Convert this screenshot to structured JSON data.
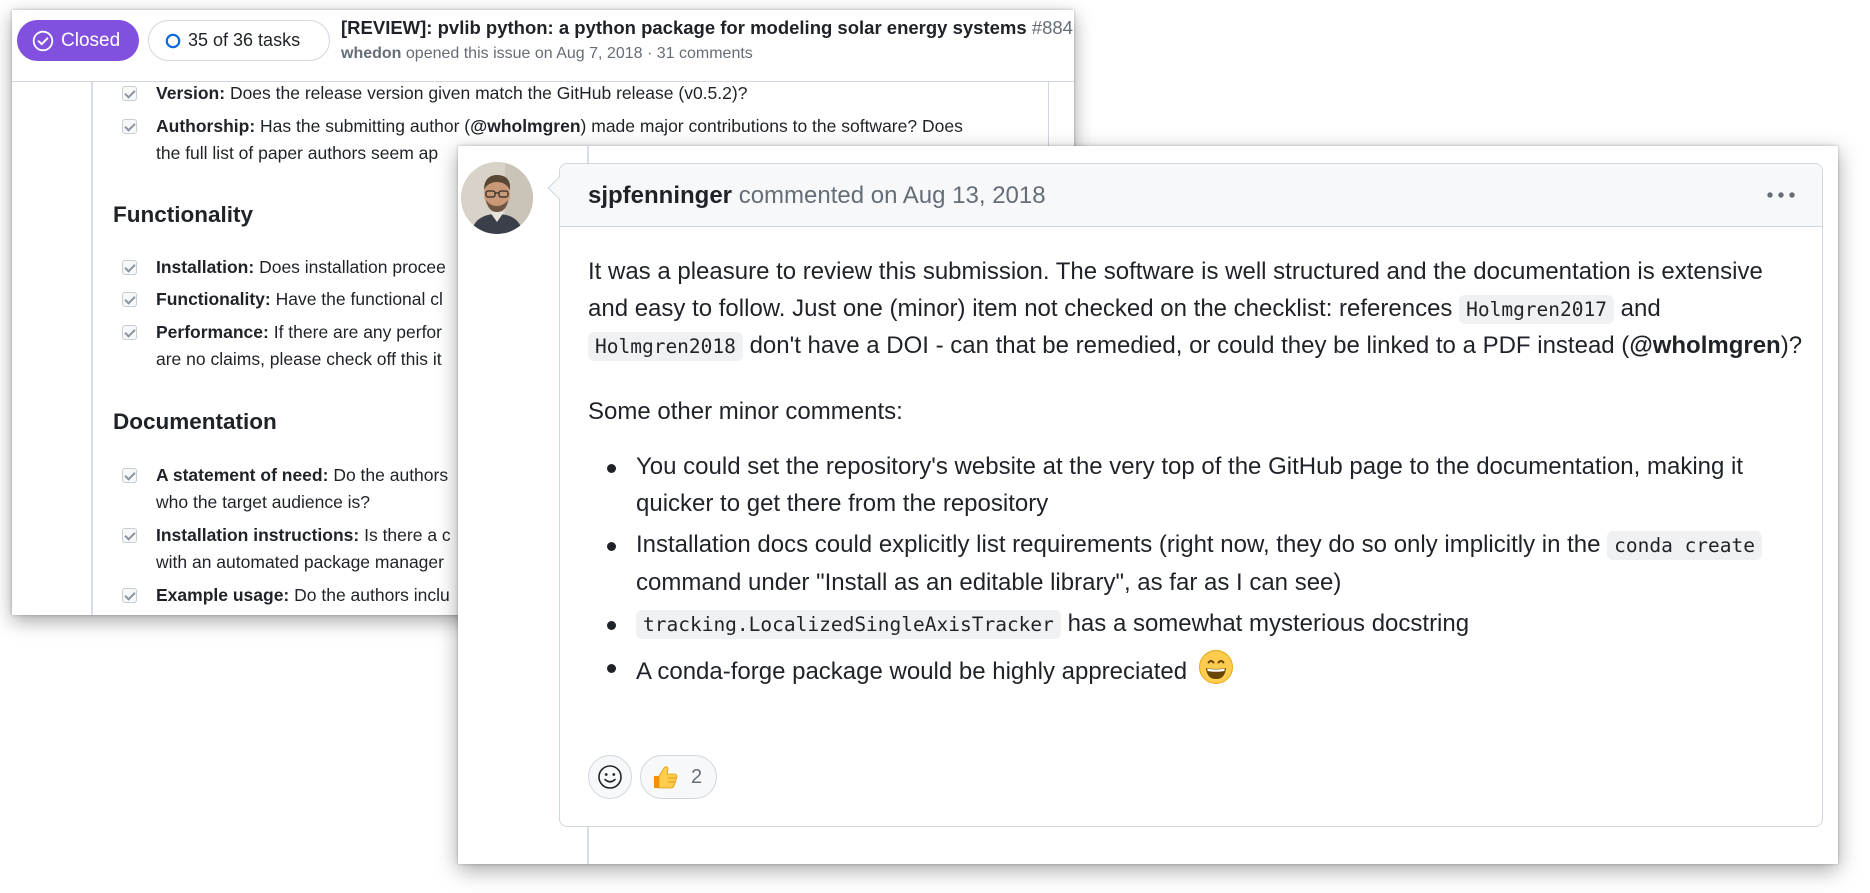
{
  "issue": {
    "state": "Closed",
    "tasks": "35 of 36 tasks",
    "title": "[REVIEW]: pvlib python: a python package for modeling solar energy systems",
    "number": "#884",
    "author": "whedon",
    "meta": "opened this issue on Aug 7, 2018 · 31 comments"
  },
  "checklist": {
    "items_top": [
      {
        "label": "Version:",
        "line1": "Does the release version given match the GitHub release (v0.5.2)?"
      },
      {
        "label": "Authorship:",
        "line1_pre": "Has the submitting author (",
        "mention": "@wholmgren",
        "line1_post": ") made major contributions to the software? Does",
        "line2": "the full list of paper authors seem ap"
      }
    ],
    "sections": [
      {
        "heading": "Functionality",
        "items": [
          {
            "label": "Installation:",
            "text": "Does installation procee"
          },
          {
            "label": "Functionality:",
            "text": "Have the functional cl"
          },
          {
            "label": "Performance:",
            "text": "If there are any perfor",
            "line2": "are no claims, please check off this it"
          }
        ]
      },
      {
        "heading": "Documentation",
        "items": [
          {
            "label": "A statement of need:",
            "text": "Do the authors",
            "line2": "who the target audience is?"
          },
          {
            "label": "Installation instructions:",
            "text": "Is there a c",
            "line2": "with an automated package manager"
          },
          {
            "label": "Example usage:",
            "text": "Do the authors inclu"
          }
        ]
      }
    ]
  },
  "comment": {
    "author": "sjpfenninger",
    "meta": "commented on Aug 13, 2018",
    "p1_a": "It was a pleasure to review this submission. The software is well structured and the documentation is extensive and easy to follow. Just one (minor) item not checked on the checklist: references",
    "code1": "Holmgren2017",
    "p1_b": "and",
    "code2": "Holmgren2018",
    "p1_c": "don't have a DOI - can that be remedied, or could they be linked to a PDF instead (",
    "mention": "@wholmgren",
    "p1_d": ")?",
    "p2": "Some other minor comments:",
    "bullets": {
      "b1": "You could set the repository's website at the very top of the GitHub page to the documentation, making it quicker to get there from the repository",
      "b2_a": "Installation docs could explicitly list requirements (right now, they do so only implicitly in the",
      "b2_code": "conda create",
      "b2_b": "command under \"Install as an editable library\", as far as I can see)",
      "b3_code": "tracking.LocalizedSingleAxisTracker",
      "b3_b": "has a somewhat mysterious docstring",
      "b4": "A conda-forge package would be highly appreciated"
    },
    "reactions": {
      "add_icon": "smiley-icon",
      "thumbs_up_icon": "thumbs-up-icon",
      "thumbs_up_count": "2"
    }
  },
  "colors": {
    "closed_purple": "#8250df",
    "border": "#d0d7de",
    "muted": "#656d76",
    "text": "#1f2328"
  }
}
